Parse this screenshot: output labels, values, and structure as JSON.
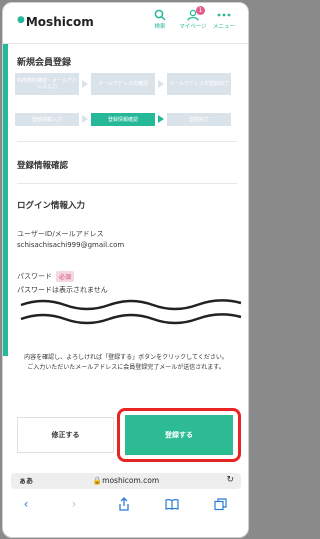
{
  "header": {
    "brand": "Moshicom",
    "icons": [
      {
        "name": "search-icon",
        "label": "検索"
      },
      {
        "name": "user-icon",
        "label": "マイページ",
        "badge": "1"
      },
      {
        "name": "more-icon",
        "label": "メニュー"
      }
    ]
  },
  "page": {
    "section_title": "新規会員登録"
  },
  "steps": {
    "row1": [
      "利用規約確認・メールアドレス入力",
      "メールアドレスの確認",
      "メールアドレス本登録完了"
    ],
    "row2": [
      "登録情報入力",
      "登録情報確認",
      "登録完了"
    ],
    "active_index": 1
  },
  "content": {
    "confirm_heading": "登録情報確認",
    "login_heading": "ログイン情報入力",
    "user_id_label": "ユーザーID/メールアドレス",
    "user_id_value": "schisachisachi999@gmail.com",
    "password_label": "パスワード",
    "required_badge": "必須",
    "password_note": "パスワードは表示されません"
  },
  "notice": {
    "line1": "内容を確認し、よろしければ「登録する」ボタンをクリックしてください。",
    "line2": "ご入力いただいたメールアドレスに会員登録完了メールが送信されます。"
  },
  "buttons": {
    "fix": "修正する",
    "register": "登録する"
  },
  "browser": {
    "aa": "ぁあ",
    "url": "moshicom.com"
  },
  "colors": {
    "accent": "#25b99a",
    "highlight": "#e62424",
    "required": "#d8437a"
  }
}
